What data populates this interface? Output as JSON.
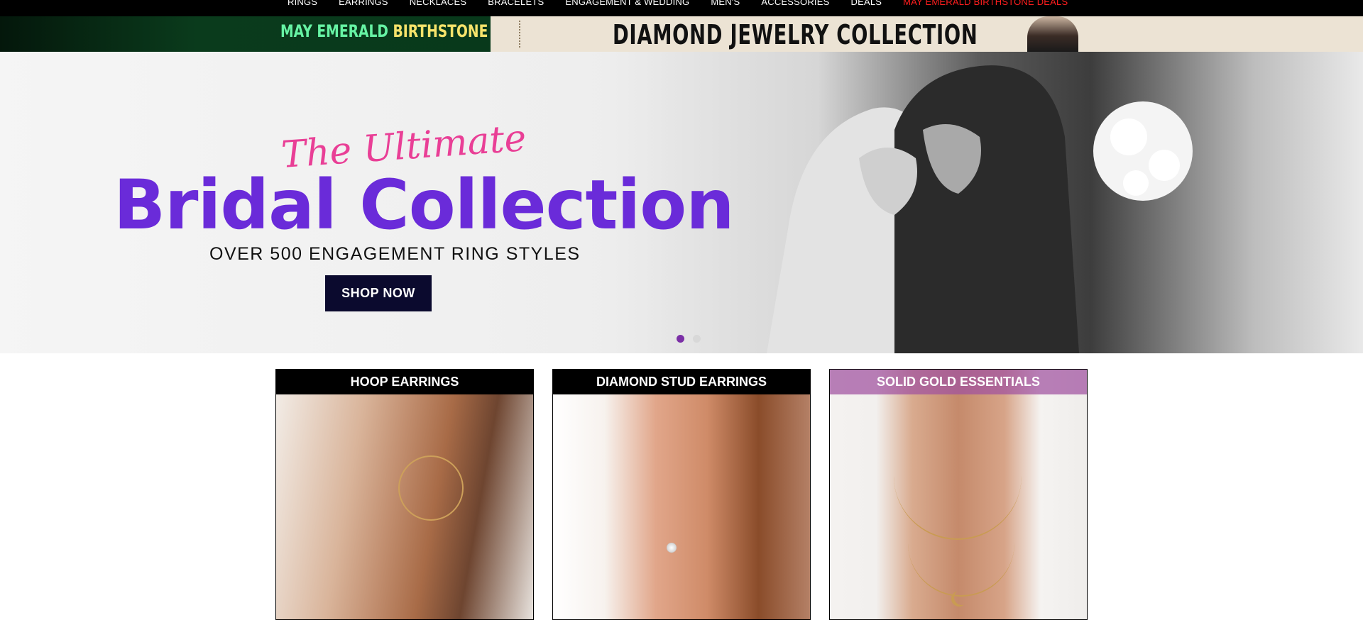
{
  "nav": {
    "items": [
      "RINGS",
      "EARRINGS",
      "NECKLACES",
      "BRACELETS",
      "ENGAGEMENT & WEDDING",
      "MEN'S",
      "ACCESSORIES",
      "DEALS",
      "MAY EMERALD BIRTHSTONE DEALS"
    ]
  },
  "promo": {
    "left_part1": "MAY EMERALD",
    "left_part2": "BIRTHSTONE DEALS",
    "right_title": "DIAMOND JEWELRY COLLECTION"
  },
  "hero": {
    "script": "The Ultimate",
    "headline": "Bridal Collection",
    "subtitle": "OVER 500 ENGAGEMENT RING STYLES",
    "button": "SHOP NOW"
  },
  "tiles": [
    {
      "label": "HOOP EARRINGS"
    },
    {
      "label": "DIAMOND STUD EARRINGS"
    },
    {
      "label": "SOLID GOLD ESSENTIALS"
    }
  ],
  "colors": {
    "headline_purple": "#6a2bd9",
    "script_pink": "#e93f96",
    "button_navy": "#0b0a2e",
    "nav_deal_red": "#ff1e1e",
    "carousel_active": "#7b2fa6"
  }
}
